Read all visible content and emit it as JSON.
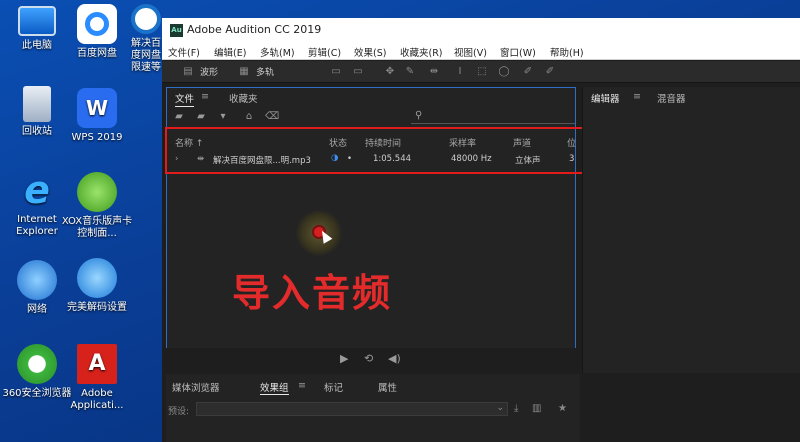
{
  "desktop": {
    "icons": [
      {
        "label": "此电脑",
        "icon": "computer-icon"
      },
      {
        "label": "百度网盘",
        "icon": "baidu-netdisk-icon"
      },
      {
        "label": "解决百度网盘限速等",
        "icon": "browser-shortcut-icon"
      },
      {
        "label": "回收站",
        "icon": "recycle-bin-icon"
      },
      {
        "label": "WPS 2019",
        "icon": "wps-icon"
      },
      {
        "label": "Internet Explorer",
        "icon": "internet-explorer-icon"
      },
      {
        "label": "XOX音乐版声卡控制面...",
        "icon": "xox-soundcard-icon"
      },
      {
        "label": "网络",
        "icon": "network-icon"
      },
      {
        "label": "完美解码设置",
        "icon": "perfect-decoder-icon"
      },
      {
        "label": "360安全浏览器",
        "icon": "360-browser-icon"
      },
      {
        "label": "Adobe Applicati...",
        "icon": "adobe-icon"
      }
    ]
  },
  "window": {
    "title": "Adobe Audition CC 2019",
    "menu": [
      "文件(F)",
      "编辑(E)",
      "多轨(M)",
      "剪辑(C)",
      "效果(S)",
      "收藏夹(R)",
      "视图(V)",
      "窗口(W)",
      "帮助(H)"
    ],
    "toolbar": {
      "waveform": "波形",
      "multitrack": "多轨"
    }
  },
  "files_panel": {
    "tabs": [
      {
        "label": "文件",
        "active": true
      },
      {
        "label": "收藏夹",
        "active": false
      }
    ],
    "columns": [
      "名称 ↑",
      "状态",
      "持续时间",
      "采样率",
      "声道",
      "位"
    ],
    "rows": [
      {
        "name": "解决百度网盘限...明.mp3",
        "status": "•",
        "duration": "1:05.544",
        "sample_rate": "48000 Hz",
        "channels": "立体声",
        "bits": "3"
      }
    ]
  },
  "caption": "导入音频",
  "lower_panel": {
    "tabs": [
      {
        "label": "媒体浏览器",
        "active": false
      },
      {
        "label": "效果组",
        "active": true
      },
      {
        "label": "标记",
        "active": false
      },
      {
        "label": "属性",
        "active": false
      }
    ],
    "preset_label": "预设:"
  },
  "right_panel": {
    "tabs": [
      {
        "label": "编辑器",
        "active": true
      },
      {
        "label": "混音器",
        "active": false
      }
    ]
  },
  "colors": {
    "accent": "#2f6ec4",
    "highlight": "#e21b1b",
    "caption": "#e32b2b"
  }
}
